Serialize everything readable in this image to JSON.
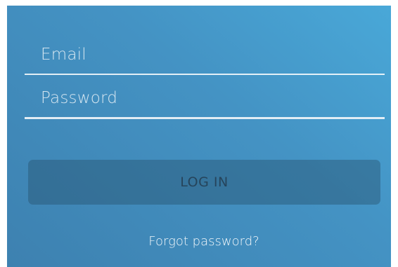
{
  "login_form": {
    "email": {
      "value": "",
      "placeholder": "Email"
    },
    "password": {
      "value": "",
      "placeholder": "Password"
    },
    "login_button_label": "LOG IN",
    "forgot_password_label": "Forgot password?"
  },
  "colors": {
    "background_top": "#49a8d8",
    "background_bottom": "#3d81b0",
    "button_text": "#254056"
  }
}
